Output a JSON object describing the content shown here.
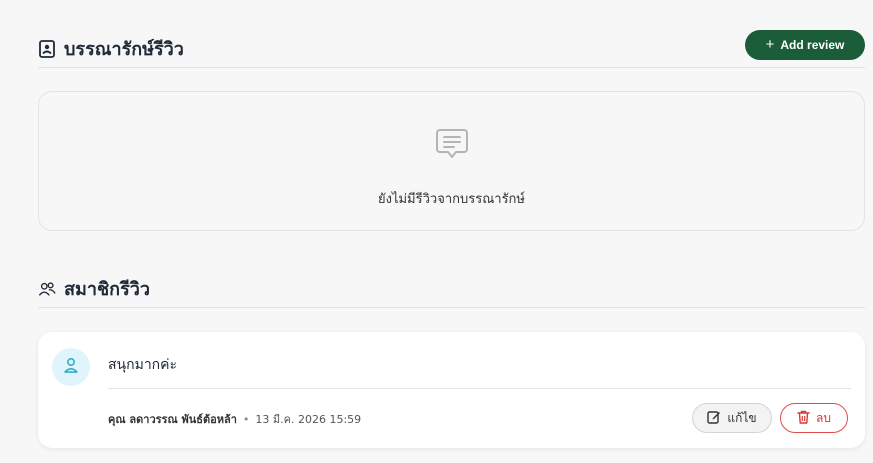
{
  "librarian_section": {
    "title": "บรรณารักษ์รีวิว",
    "icon": "id-badge-icon",
    "add_button_label": "Add review",
    "add_button_icon": "plus-icon",
    "empty_message": "ยังไม่มีรีวิวจากบรรณารักษ์",
    "empty_icon": "message-icon"
  },
  "member_section": {
    "title": "สมาชิกรีวิว",
    "icon": "users-icon",
    "reviews": [
      {
        "text": "สนุกมากค่ะ",
        "author": "คุณ ลดาวรรณ พันธ์ต้อหล้า",
        "separator": "•",
        "date": "13 มี.ค. 2026 15:59",
        "edit_label": "แก้ไข",
        "delete_label": "ลบ"
      }
    ]
  },
  "colors": {
    "primary": "#1a5d38",
    "danger": "#e34b4b",
    "avatar_bg": "#dff4fb",
    "avatar_fg": "#2aa7c9"
  }
}
